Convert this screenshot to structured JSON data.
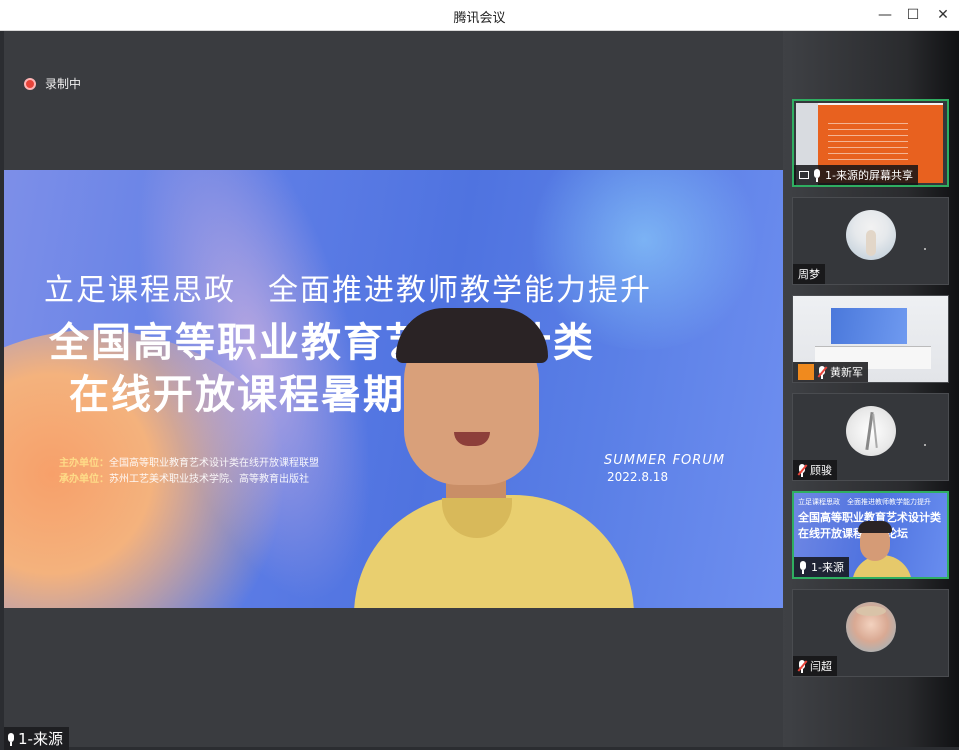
{
  "window": {
    "title": "腾讯会议",
    "controls": {
      "minimize": "—",
      "maximize": "☐",
      "close": "✕"
    }
  },
  "recording": {
    "label": "录制中",
    "color": "#e8443a"
  },
  "main_video": {
    "slide": {
      "line1": "立足课程思政　全面推进教师教学能力提升",
      "line2": "全国高等职业教育艺术设计类",
      "line3": "在线开放课程暑期论坛",
      "host_label": "主办单位：",
      "host_value": "全国高等职业教育艺术设计类在线开放课程联盟",
      "organizer_label": "承办单位：",
      "organizer_value": "苏州工艺美术职业技术学院、高等教育出版社",
      "forum_tag": "SUMMER FORUM",
      "date": "2022.8.18"
    },
    "speaker_name": "1-来源"
  },
  "participants": [
    {
      "name": "1-来源的屏幕共享",
      "type": "screen-share",
      "active": true,
      "mic": "on"
    },
    {
      "name": "周梦",
      "type": "avatar",
      "active": false,
      "mic": "none"
    },
    {
      "name": "黄新军",
      "type": "video-room",
      "active": false,
      "mic": "muted"
    },
    {
      "name": "顾骏",
      "type": "avatar",
      "active": false,
      "mic": "muted"
    },
    {
      "name": "1-来源",
      "type": "video-speaker",
      "active": true,
      "mic": "on"
    },
    {
      "name": "闫超",
      "type": "avatar",
      "active": false,
      "mic": "muted"
    }
  ],
  "mini_slide": {
    "line1": "立足课程思政　全面推进教师教学能力提升",
    "line2": "全国高等职业教育艺术设计类",
    "line3": "在线开放课程暑期论坛"
  },
  "colors": {
    "active_border": "#2fae61",
    "accent_orange": "#e8611f"
  }
}
